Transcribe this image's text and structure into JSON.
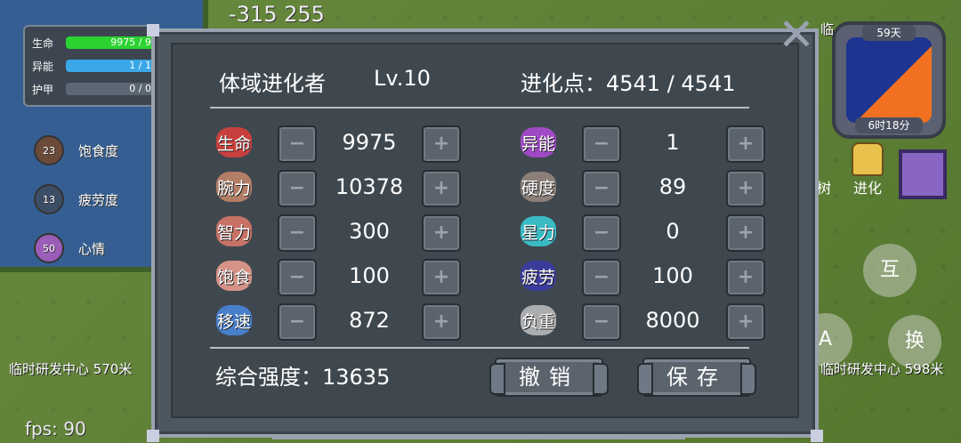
{
  "hud": {
    "coords": "-315  255",
    "fps": "fps: 90",
    "status": [
      {
        "label": "生命",
        "value": "9975 / 9",
        "color": "#2bd331",
        "fill": 1.0
      },
      {
        "label": "异能",
        "value": "1 / 1",
        "color": "#3aa7e8",
        "fill": 1.0
      },
      {
        "label": "护甲",
        "value": "0 / 0",
        "color": "#5c6773",
        "fill": 0.0
      }
    ],
    "needs": [
      {
        "value": "23",
        "label": "饱食度",
        "color": "#6b4a3a"
      },
      {
        "value": "13",
        "label": "疲劳度",
        "color": "#3c4d66"
      },
      {
        "value": "50",
        "label": "心情",
        "color": "#9b5db8"
      }
    ],
    "clock": {
      "day": "59天",
      "time": "6时18分"
    },
    "tree_label": "树",
    "evolve_label": "进化",
    "interact_label": "互",
    "a_label": "A",
    "swap_label": "换",
    "dist_left": "临时研发中心 570米",
    "dist_right": "临时研发中心 598米",
    "top_right_partial": "临"
  },
  "panel": {
    "title": "体域进化者",
    "level": "Lv.10",
    "points_label": "进化点：4541 / 4541",
    "total_label": "综合强度：13635",
    "undo_label": "撤销",
    "save_label": "保存",
    "left_stats": [
      {
        "name": "生命",
        "value": "9975",
        "icon": "heart-icon",
        "color": "#e0403a"
      },
      {
        "name": "腕力",
        "value": "10378",
        "icon": "fist-icon",
        "color": "#c9876a"
      },
      {
        "name": "智力",
        "value": "300",
        "icon": "brain-icon",
        "color": "#e07a6a"
      },
      {
        "name": "饱食",
        "value": "100",
        "icon": "meat-icon",
        "color": "#f0a090"
      },
      {
        "name": "移速",
        "value": "872",
        "icon": "boot-icon",
        "color": "#4a8ae0"
      }
    ],
    "right_stats": [
      {
        "name": "异能",
        "value": "1",
        "icon": "star-icon",
        "color": "#b04bd8"
      },
      {
        "name": "硬度",
        "value": "89",
        "icon": "shell-icon",
        "color": "#9a8a80"
      },
      {
        "name": "星力",
        "value": "0",
        "icon": "crystal-icon",
        "color": "#3ad0d8"
      },
      {
        "name": "疲劳",
        "value": "100",
        "icon": "moon-icon",
        "color": "#3a3aa8"
      },
      {
        "name": "负重",
        "value": "8000",
        "icon": "weight-icon",
        "color": "#c0c0c0"
      }
    ],
    "minus_glyph": "−",
    "plus_glyph": "+"
  }
}
